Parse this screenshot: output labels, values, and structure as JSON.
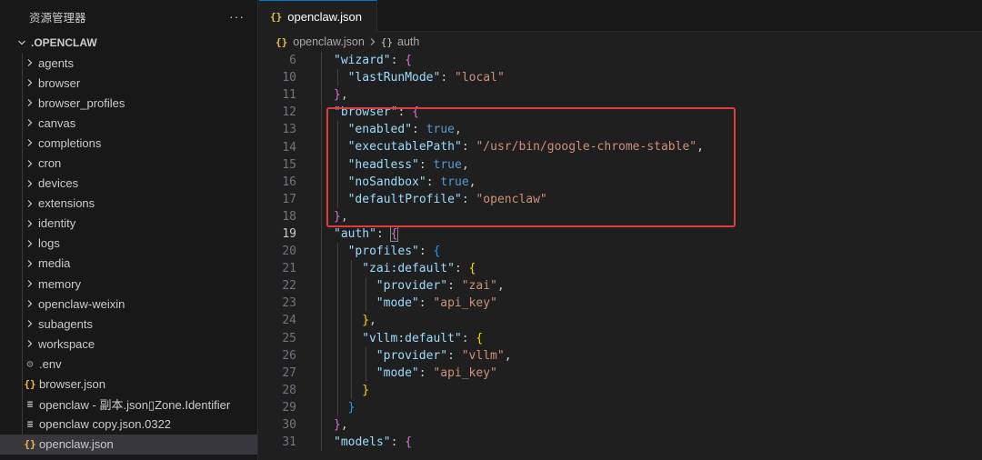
{
  "explorer": {
    "title": "资源管理器",
    "more_actions": "···",
    "root_folder": ".OPENCLAW",
    "folders": [
      "agents",
      "browser",
      "browser_profiles",
      "canvas",
      "completions",
      "cron",
      "devices",
      "extensions",
      "identity",
      "logs",
      "media",
      "memory",
      "openclaw-weixin",
      "subagents",
      "workspace"
    ],
    "files": [
      {
        "icon": "gear-icon",
        "glyph": "⚙",
        "name": ".env"
      },
      {
        "icon": "json-icon",
        "glyph": "{}",
        "name": "browser.json"
      },
      {
        "icon": "lines-icon",
        "glyph": "≡",
        "name": "openclaw - 副本.json\u0000Zone.Identifier"
      },
      {
        "icon": "lines-icon",
        "glyph": "≡",
        "name": "openclaw copy.json.0322"
      },
      {
        "icon": "json-icon",
        "glyph": "{}",
        "name": "openclaw.json",
        "selected": true
      }
    ]
  },
  "tabs": [
    {
      "icon_glyph": "{}",
      "label": "openclaw.json",
      "active": true
    }
  ],
  "breadcrumb": {
    "file_glyph": "{}",
    "file": "openclaw.json",
    "obj_glyph": "{}",
    "symbol": "auth"
  },
  "highlight_color": "#e23b3b",
  "code_lines": [
    {
      "n": "6",
      "tokens": [
        [
          "b1",
          "\"wizard\""
        ],
        [
          "p",
          ": "
        ],
        [
          "br1",
          "{"
        ]
      ]
    },
    {
      "n": "10",
      "tokens": [
        [
          "b2",
          "\"lastRunMode\""
        ],
        [
          "p",
          ": "
        ],
        [
          "s",
          "\"local\""
        ]
      ]
    },
    {
      "n": "11",
      "tokens": [
        [
          "br1",
          "}"
        ],
        [
          "p",
          ","
        ]
      ]
    },
    {
      "n": "12",
      "tokens": [
        [
          "b1",
          "\"browser\""
        ],
        [
          "p",
          ": "
        ],
        [
          "br1",
          "{"
        ]
      ]
    },
    {
      "n": "13",
      "tokens": [
        [
          "b2",
          "\"enabled\""
        ],
        [
          "p",
          ": "
        ],
        [
          "b",
          "true"
        ],
        [
          "p",
          ","
        ]
      ]
    },
    {
      "n": "14",
      "tokens": [
        [
          "b2",
          "\"executablePath\""
        ],
        [
          "p",
          ": "
        ],
        [
          "s",
          "\"/usr/bin/google-chrome-stable\""
        ],
        [
          "p",
          ","
        ]
      ]
    },
    {
      "n": "15",
      "tokens": [
        [
          "b2",
          "\"headless\""
        ],
        [
          "p",
          ": "
        ],
        [
          "b",
          "true"
        ],
        [
          "p",
          ","
        ]
      ]
    },
    {
      "n": "16",
      "tokens": [
        [
          "b2",
          "\"noSandbox\""
        ],
        [
          "p",
          ": "
        ],
        [
          "b",
          "true"
        ],
        [
          "p",
          ","
        ]
      ]
    },
    {
      "n": "17",
      "tokens": [
        [
          "b2",
          "\"defaultProfile\""
        ],
        [
          "p",
          ": "
        ],
        [
          "s",
          "\"openclaw\""
        ]
      ]
    },
    {
      "n": "18",
      "tokens": [
        [
          "br1",
          "}"
        ],
        [
          "p",
          ","
        ]
      ]
    },
    {
      "n": "19",
      "tokens": [
        [
          "b1",
          "\"auth\""
        ],
        [
          "p",
          ": "
        ],
        [
          "br1m",
          "{"
        ]
      ],
      "active": true
    },
    {
      "n": "20",
      "tokens": [
        [
          "b2",
          "\"profiles\""
        ],
        [
          "p",
          ": "
        ],
        [
          "br2",
          "{"
        ]
      ]
    },
    {
      "n": "21",
      "tokens": [
        [
          "b3",
          "\"zai:default\""
        ],
        [
          "p",
          ": "
        ],
        [
          "br3",
          "{"
        ]
      ]
    },
    {
      "n": "22",
      "tokens": [
        [
          "b4",
          "\"provider\""
        ],
        [
          "p",
          ": "
        ],
        [
          "s",
          "\"zai\""
        ],
        [
          "p",
          ","
        ]
      ]
    },
    {
      "n": "23",
      "tokens": [
        [
          "b4",
          "\"mode\""
        ],
        [
          "p",
          ": "
        ],
        [
          "s",
          "\"api_key\""
        ]
      ]
    },
    {
      "n": "24",
      "tokens": [
        [
          "b3br3",
          "}"
        ],
        [
          "p",
          ","
        ]
      ]
    },
    {
      "n": "25",
      "tokens": [
        [
          "b3",
          "\"vllm:default\""
        ],
        [
          "p",
          ": "
        ],
        [
          "br3",
          "{"
        ]
      ]
    },
    {
      "n": "26",
      "tokens": [
        [
          "b4",
          "\"provider\""
        ],
        [
          "p",
          ": "
        ],
        [
          "s",
          "\"vllm\""
        ],
        [
          "p",
          ","
        ]
      ]
    },
    {
      "n": "27",
      "tokens": [
        [
          "b4",
          "\"mode\""
        ],
        [
          "p",
          ": "
        ],
        [
          "s",
          "\"api_key\""
        ]
      ]
    },
    {
      "n": "28",
      "tokens": [
        [
          "b3br3",
          "}"
        ]
      ]
    },
    {
      "n": "29",
      "tokens": [
        [
          "b2br2",
          "}"
        ]
      ]
    },
    {
      "n": "30",
      "tokens": [
        [
          "br1m",
          "}"
        ],
        [
          "p",
          ","
        ]
      ]
    },
    {
      "n": "31",
      "tokens": [
        [
          "b1",
          "\"models\""
        ],
        [
          "p",
          ": "
        ],
        [
          "br1",
          "{"
        ]
      ]
    }
  ]
}
